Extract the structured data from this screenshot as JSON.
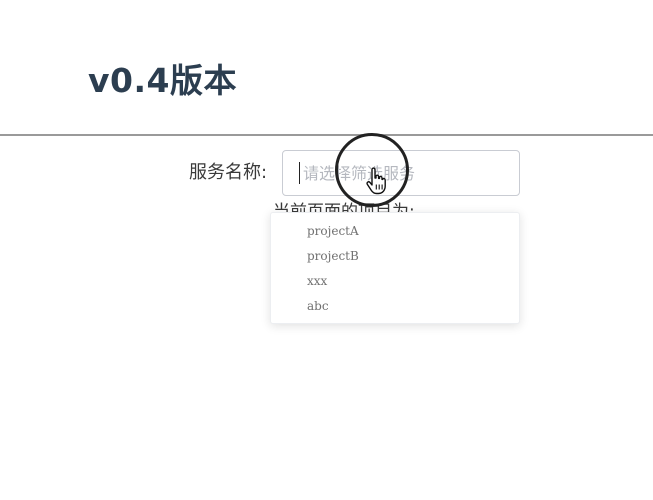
{
  "header": {
    "title": "v0.4版本"
  },
  "form": {
    "service_label": "服务名称:",
    "service_input": {
      "value": "",
      "placeholder": "请选择筛选服务"
    },
    "current_project_label": "当前页面的项目为:"
  },
  "dropdown": {
    "options": [
      "projectA",
      "projectB",
      "xxx",
      "abc"
    ]
  },
  "icons": {
    "cursor": "hand-pointer-icon"
  }
}
